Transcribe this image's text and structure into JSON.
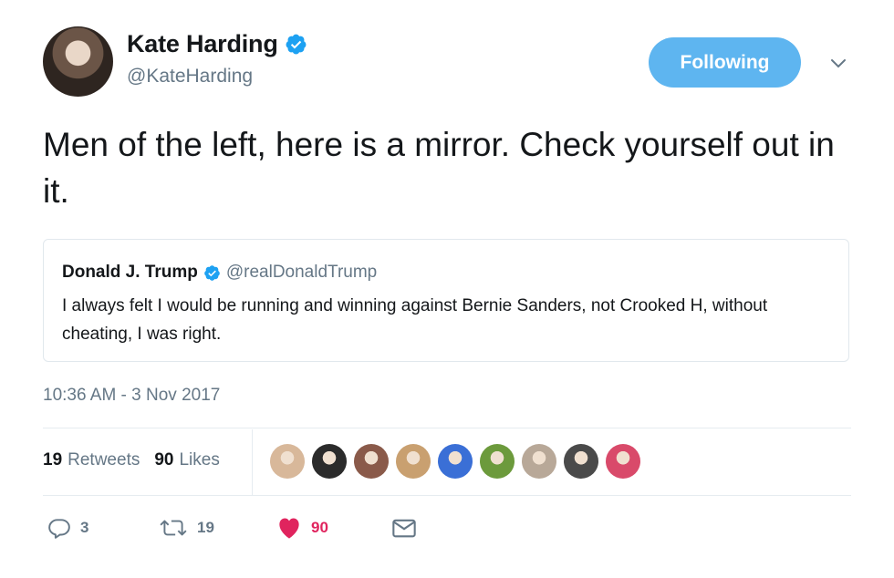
{
  "author": {
    "name": "Kate Harding",
    "handle": "@KateHarding",
    "verified": true
  },
  "follow_button": {
    "label": "Following"
  },
  "tweet": {
    "text": "Men of the left, here is a mirror. Check yourself out in it."
  },
  "quoted_tweet": {
    "name": "Donald J. Trump",
    "handle": "@realDonaldTrump",
    "verified": true,
    "text": "I always felt I would be running and winning against Bernie Sanders, not Crooked H, without cheating, I was right."
  },
  "timestamp": "10:36 AM - 3 Nov 2017",
  "stats": {
    "retweets_count": "19",
    "retweets_label": "Retweets",
    "likes_count": "90",
    "likes_label": "Likes"
  },
  "liker_avatars": [
    "#d8b89a",
    "#2b2b2b",
    "#8a5a4a",
    "#c9a070",
    "#3a6fd6",
    "#6c9a3c",
    "#b8a898",
    "#4a4a4a",
    "#d94a6a"
  ],
  "actions": {
    "reply_count": "3",
    "retweet_count": "19",
    "like_count": "90"
  },
  "colors": {
    "accent": "#1da1f2",
    "like": "#e0245e",
    "muted": "#657786",
    "verified": "#1da1f2"
  }
}
